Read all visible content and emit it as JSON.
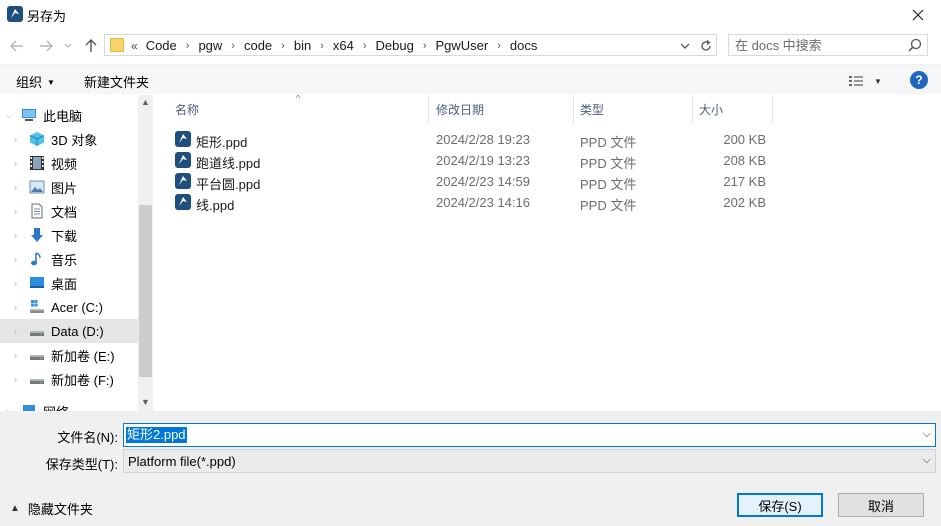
{
  "window": {
    "title": "另存为",
    "close_label": "✕"
  },
  "nav": {
    "address_crumbs": [
      "Code",
      "pgw",
      "code",
      "bin",
      "x64",
      "Debug",
      "PgwUser",
      "docs"
    ],
    "address_lead": "«",
    "search_placeholder": "在 docs 中搜索"
  },
  "toolbar": {
    "organize_label": "组织",
    "new_folder_label": "新建文件夹",
    "help_label": "?"
  },
  "sidebar": {
    "items": [
      {
        "label": "此电脑",
        "icon": "computer-icon"
      },
      {
        "label": "3D 对象",
        "icon": "cube-3d-icon"
      },
      {
        "label": "视频",
        "icon": "video-icon"
      },
      {
        "label": "图片",
        "icon": "picture-icon"
      },
      {
        "label": "文档",
        "icon": "document-icon"
      },
      {
        "label": "下载",
        "icon": "download-icon"
      },
      {
        "label": "音乐",
        "icon": "music-icon"
      },
      {
        "label": "桌面",
        "icon": "desktop-icon"
      },
      {
        "label": "Acer (C:)",
        "icon": "system-drive-icon"
      },
      {
        "label": "Data (D:)",
        "icon": "drive-icon",
        "selected": true
      },
      {
        "label": "新加卷 (E:)",
        "icon": "drive-icon"
      },
      {
        "label": "新加卷 (F:)",
        "icon": "drive-icon"
      },
      {
        "label": "网络",
        "icon": "network-icon"
      }
    ]
  },
  "files": {
    "columns": {
      "name": "名称",
      "date": "修改日期",
      "type": "类型",
      "size": "大小"
    },
    "rows": [
      {
        "name": "矩形.ppd",
        "date": "2024/2/28 19:23",
        "type": "PPD 文件",
        "size": "200 KB"
      },
      {
        "name": "跑道线.ppd",
        "date": "2024/2/19 13:23",
        "type": "PPD 文件",
        "size": "208 KB"
      },
      {
        "name": "平台圆.ppd",
        "date": "2024/2/23 14:59",
        "type": "PPD 文件",
        "size": "217 KB"
      },
      {
        "name": "线.ppd",
        "date": "2024/2/23 14:16",
        "type": "PPD 文件",
        "size": "202 KB"
      }
    ]
  },
  "form": {
    "filename_label": "文件名(N):",
    "filename_value": "矩形2.ppd",
    "filetype_label": "保存类型(T):",
    "filetype_value": "Platform file(*.ppd)",
    "hide_folders_label": "隐藏文件夹",
    "save_label": "保存(S)",
    "cancel_label": "取消"
  },
  "colors": {
    "accent": "#0078d7",
    "selection_bg": "#e5e5e5",
    "app_icon": "#1e4f7f"
  }
}
